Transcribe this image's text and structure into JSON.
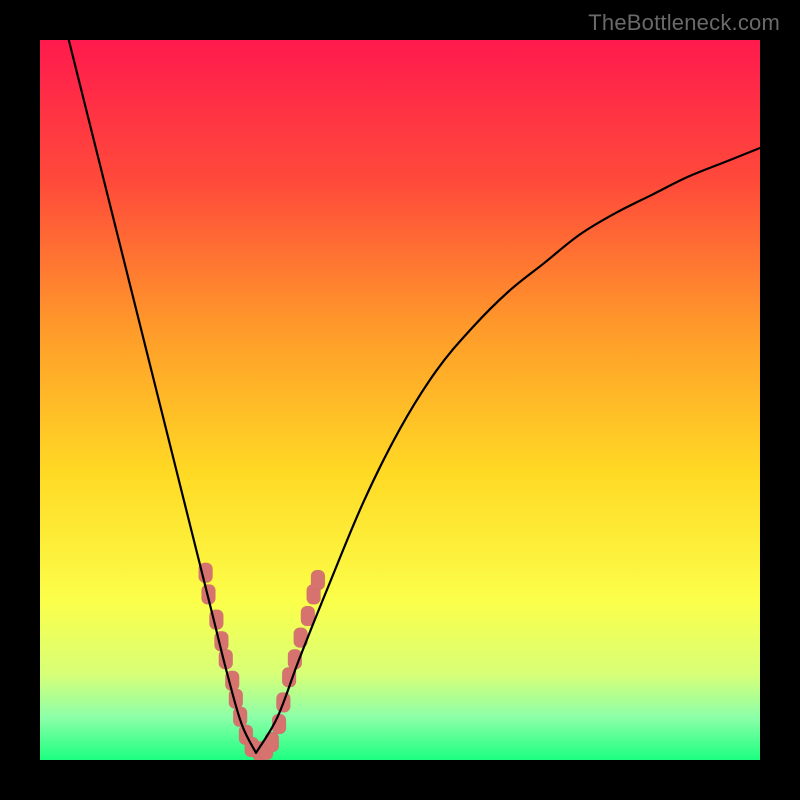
{
  "watermark": {
    "text": "TheBottleneck.com"
  },
  "colors": {
    "gradient_stops": [
      {
        "offset": 0.0,
        "color": "#ff1a4d"
      },
      {
        "offset": 0.2,
        "color": "#ff4b3a"
      },
      {
        "offset": 0.4,
        "color": "#ff9a2a"
      },
      {
        "offset": 0.6,
        "color": "#ffd924"
      },
      {
        "offset": 0.78,
        "color": "#fbff4a"
      },
      {
        "offset": 0.88,
        "color": "#d8ff77"
      },
      {
        "offset": 0.94,
        "color": "#8dffa8"
      },
      {
        "offset": 1.0,
        "color": "#1cff81"
      }
    ],
    "marker_fill": "#d6736f",
    "curve_stroke": "#000000",
    "frame_background": "#000000"
  },
  "chart_data": {
    "type": "line",
    "title": "",
    "xlabel": "",
    "ylabel": "",
    "x_range": [
      0,
      100
    ],
    "y_range": [
      0,
      100
    ],
    "minimum_x": 30,
    "series": [
      {
        "name": "bottleneck-curve-left",
        "x": [
          4.0,
          6.0,
          8.0,
          10.0,
          12.0,
          14.0,
          16.0,
          18.0,
          20.0,
          22.0,
          24.0,
          26.0,
          28.0,
          30.0
        ],
        "y": [
          100.0,
          92.0,
          84.0,
          76.0,
          68.0,
          60.0,
          52.0,
          44.0,
          36.0,
          28.0,
          20.0,
          12.0,
          5.0,
          1.0
        ]
      },
      {
        "name": "bottleneck-curve-right",
        "x": [
          30.0,
          33.0,
          36.0,
          40.0,
          45.0,
          50.0,
          55.0,
          60.0,
          65.0,
          70.0,
          75.0,
          80.0,
          85.0,
          90.0,
          95.0,
          100.0
        ],
        "y": [
          1.0,
          6.0,
          14.0,
          24.0,
          36.0,
          46.0,
          54.0,
          60.0,
          65.0,
          69.0,
          73.0,
          76.0,
          78.5,
          81.0,
          83.0,
          85.0
        ]
      }
    ],
    "markers": [
      {
        "x": 23.0,
        "y": 26.0
      },
      {
        "x": 23.4,
        "y": 23.0
      },
      {
        "x": 24.5,
        "y": 19.5
      },
      {
        "x": 25.2,
        "y": 16.5
      },
      {
        "x": 25.8,
        "y": 14.0
      },
      {
        "x": 26.7,
        "y": 11.0
      },
      {
        "x": 27.2,
        "y": 8.5
      },
      {
        "x": 27.8,
        "y": 6.0
      },
      {
        "x": 28.6,
        "y": 3.5
      },
      {
        "x": 29.4,
        "y": 1.8
      },
      {
        "x": 30.5,
        "y": 1.2
      },
      {
        "x": 31.4,
        "y": 1.4
      },
      {
        "x": 32.2,
        "y": 2.5
      },
      {
        "x": 33.2,
        "y": 5.0
      },
      {
        "x": 33.8,
        "y": 8.0
      },
      {
        "x": 34.6,
        "y": 11.5
      },
      {
        "x": 35.4,
        "y": 14.0
      },
      {
        "x": 36.2,
        "y": 17.0
      },
      {
        "x": 37.2,
        "y": 20.0
      },
      {
        "x": 38.0,
        "y": 23.0
      },
      {
        "x": 38.6,
        "y": 25.0
      }
    ]
  }
}
